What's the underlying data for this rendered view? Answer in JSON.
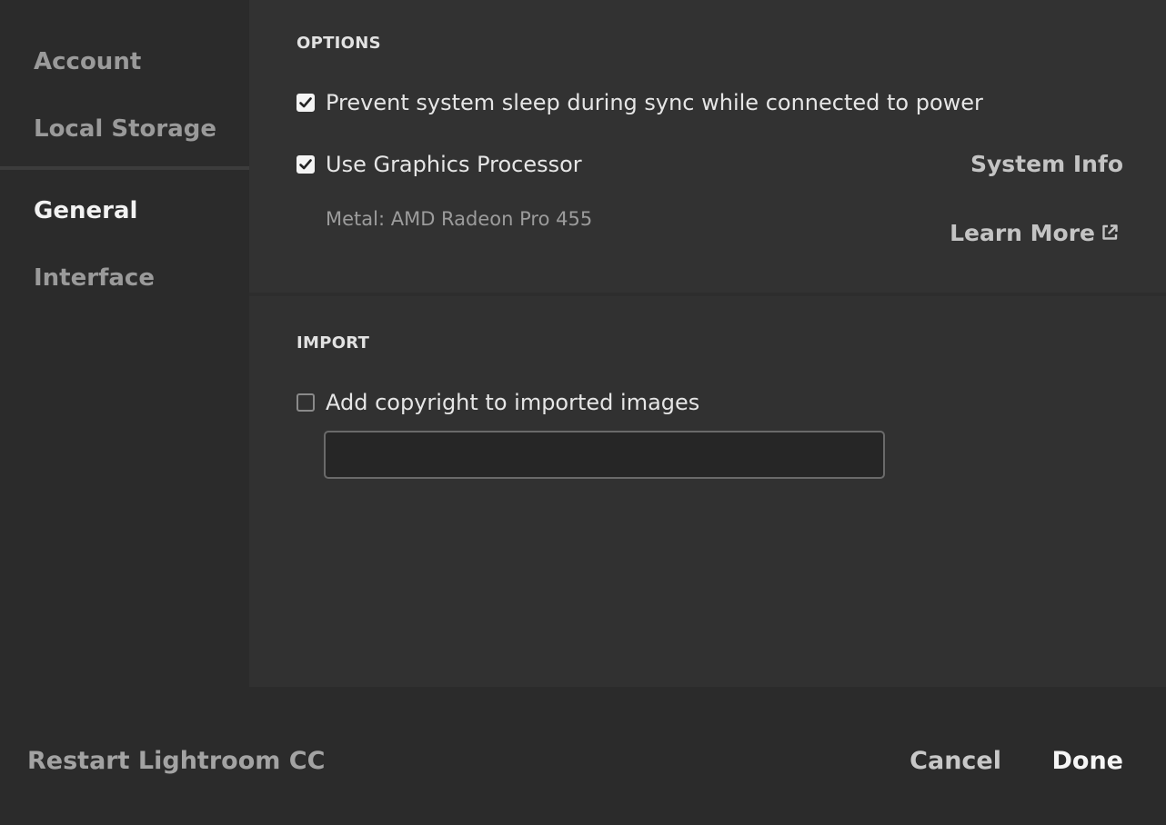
{
  "sidebar": {
    "items": [
      {
        "label": "Account"
      },
      {
        "label": "Local Storage"
      },
      {
        "label": "General",
        "active": true
      },
      {
        "label": "Interface"
      }
    ]
  },
  "options": {
    "title": "OPTIONS",
    "prevent_sleep": {
      "label": "Prevent system sleep during sync while connected to power",
      "checked": true
    },
    "use_gpu": {
      "label": "Use Graphics Processor",
      "checked": true
    },
    "gpu_info": "Metal: AMD Radeon Pro 455",
    "system_info_label": "System Info",
    "learn_more_label": "Learn More",
    "learn_more_icon": "external-link-icon"
  },
  "import": {
    "title": "IMPORT",
    "add_copyright": {
      "label": "Add copyright to imported images",
      "checked": false
    },
    "copyright_value": ""
  },
  "footer": {
    "restart_label": "Restart Lightroom CC",
    "cancel_label": "Cancel",
    "done_label": "Done"
  },
  "colors": {
    "background": "#2b2b2b",
    "panel": "#323232",
    "text_active": "#f2f2f2",
    "text_muted": "#9a9a9a"
  }
}
